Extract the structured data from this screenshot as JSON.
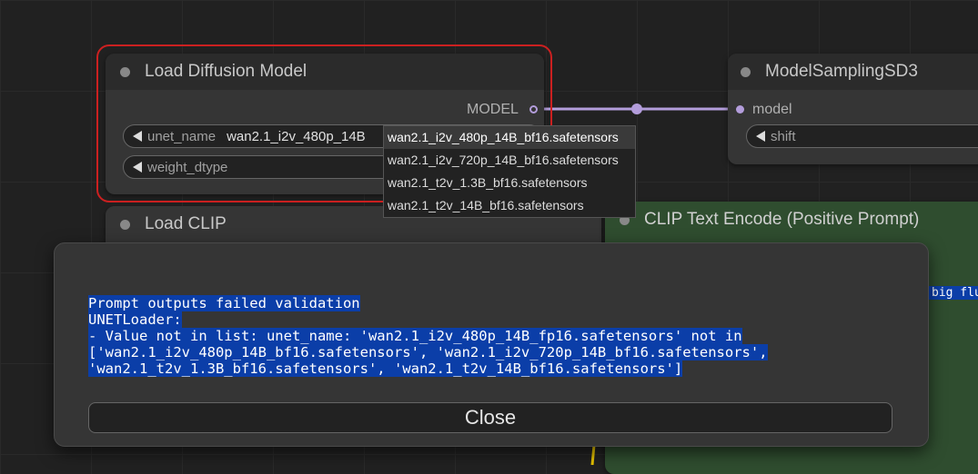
{
  "nodes": {
    "load_diffusion": {
      "title": "Load Diffusion Model",
      "output_label": "MODEL",
      "widgets": [
        {
          "label": "unet_name",
          "value": "wan2.1_i2v_480p_14B"
        },
        {
          "label": "weight_dtype",
          "value": ""
        }
      ]
    },
    "model_sampling": {
      "title": "ModelSamplingSD3",
      "input_label": "model",
      "widget_label": "shift"
    },
    "load_clip": {
      "title": "Load CLIP"
    },
    "clip_text_encode": {
      "title": "CLIP Text Encode (Positive Prompt)",
      "snippet": "big flu"
    }
  },
  "dropdown": {
    "options": [
      "wan2.1_i2v_480p_14B_bf16.safetensors",
      "wan2.1_i2v_720p_14B_bf16.safetensors",
      "wan2.1_t2v_1.3B_bf16.safetensors",
      "wan2.1_t2v_14B_bf16.safetensors"
    ],
    "selected_index": 0
  },
  "dialog": {
    "lines": [
      "Prompt outputs failed validation",
      "UNETLoader:",
      "- Value not in list: unet_name: 'wan2.1_i2v_480p_14B_fp16.safetensors' not in",
      "['wan2.1_i2v_480p_14B_bf16.safetensors', 'wan2.1_i2v_720p_14B_bf16.safetensors',",
      "'wan2.1_t2v_1.3B_bf16.safetensors', 'wan2.1_t2v_14B_bf16.safetensors']"
    ],
    "close_label": "Close"
  },
  "colors": {
    "selection_outline": "#cc2020",
    "link_color": "#b39ddb",
    "text_highlight": "#0b3ea8",
    "clip_node_green": "#2f4d2f"
  }
}
